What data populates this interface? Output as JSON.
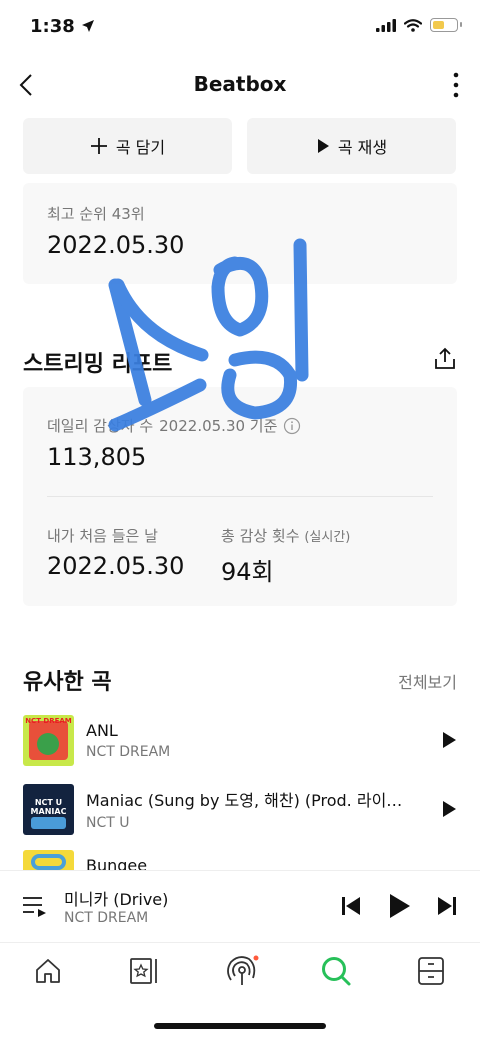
{
  "status": {
    "time": "1:38"
  },
  "header": {
    "title": "Beatbox"
  },
  "actions": {
    "add_label": "곡 담기",
    "play_label": "곡 재생"
  },
  "rank_card": {
    "label": "최고 순위 43위",
    "date": "2022.05.30"
  },
  "stream_report": {
    "title": "스트리밍 리포트",
    "daily_label": "데일리 감상자 수",
    "daily_date": "2022.05.30 기준",
    "daily_value": "113,805",
    "first_listen_label": "내가 처음 들은 날",
    "first_listen_value": "2022.05.30",
    "total_plays_label": "총 감상 횟수",
    "total_plays_sub": "(실시간)",
    "total_plays_value": "94회"
  },
  "similar": {
    "title": "유사한 곡",
    "see_all": "전체보기",
    "songs": [
      {
        "title": "ANL",
        "artist": "NCT DREAM",
        "cover_text": "NCT DREAM"
      },
      {
        "title": "Maniac (Sung by 도영, 해찬) (Prod. 라이…",
        "artist": "NCT U",
        "cover_text": "NCT U MANIAC"
      },
      {
        "title": "Bungee",
        "artist": ""
      }
    ]
  },
  "now_playing": {
    "title": "미니카 (Drive)",
    "artist": "NCT DREAM"
  },
  "tabs": [
    {
      "name": "home"
    },
    {
      "name": "library"
    },
    {
      "name": "podcast"
    },
    {
      "name": "search"
    },
    {
      "name": "storage"
    }
  ],
  "handwriting": {
    "text": "스밍"
  },
  "colors": {
    "accent": "#27c059",
    "handwriting": "#3a7fe0",
    "badge": "#ff5a3c"
  }
}
